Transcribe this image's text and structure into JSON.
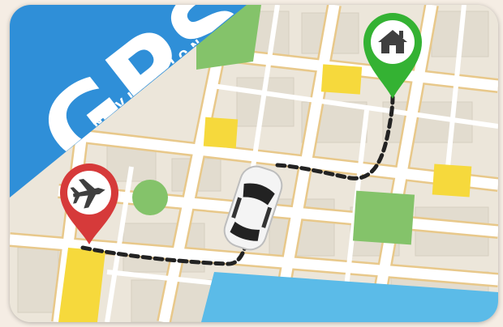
{
  "banner": {
    "title": "GPS",
    "subtitle": "NAVIGATION"
  },
  "pins": {
    "start": {
      "icon": "airplane-icon",
      "color": "#d63a3a"
    },
    "destination": {
      "icon": "home-icon",
      "color": "#34b233"
    }
  },
  "vehicle": {
    "icon": "car-icon"
  },
  "colors": {
    "banner": "#2f8fd8",
    "park": "#84c36a",
    "water": "#5bbbe8",
    "block_highlight": "#f6d93c",
    "road": "#ffffff",
    "road_edge": "#e8c88a",
    "map_base": "#ece6da",
    "route": "#222222"
  }
}
